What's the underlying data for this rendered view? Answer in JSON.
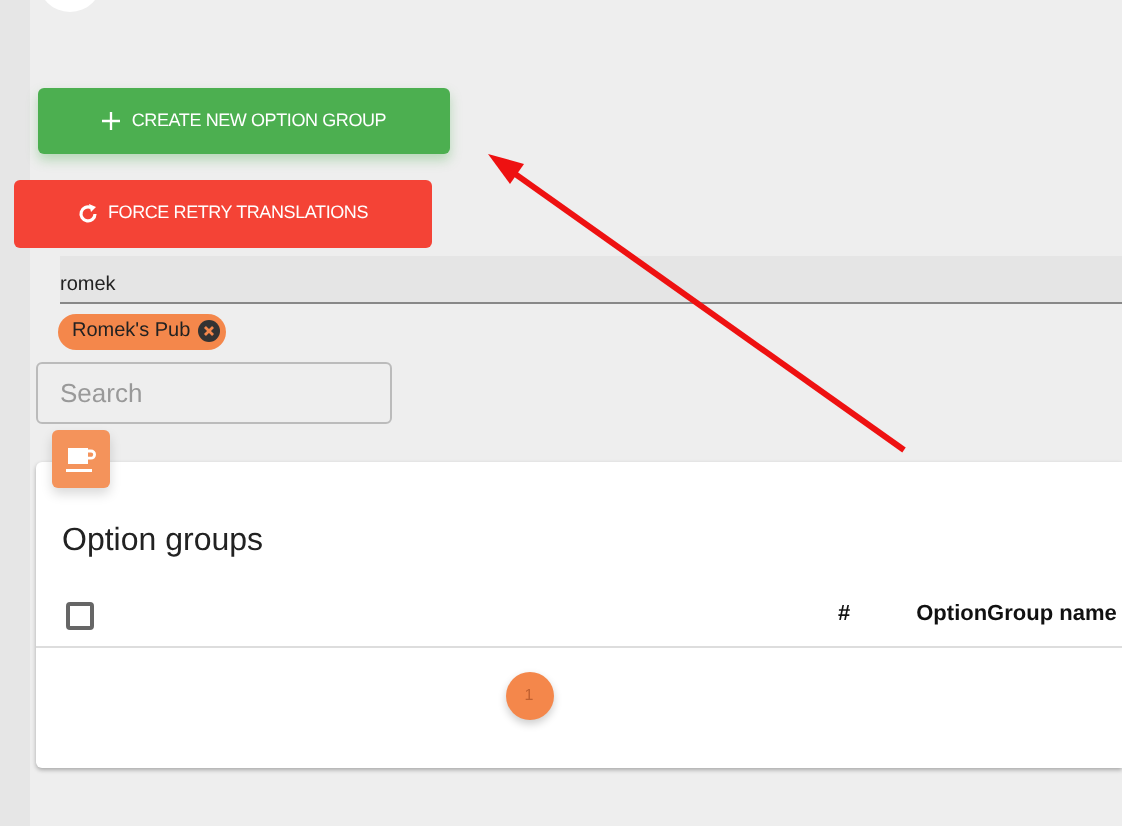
{
  "create_button": {
    "label": "CREATE NEW OPTION GROUP"
  },
  "retry_button": {
    "label": "FORCE RETRY TRANSLATIONS"
  },
  "restaurant_filter": {
    "value": "romek",
    "chips": [
      {
        "label": "Romek's Pub"
      }
    ]
  },
  "search": {
    "placeholder": "Search"
  },
  "card": {
    "title": "Option groups",
    "columns": [
      {
        "kind": "checkbox",
        "checked": false
      },
      {
        "kind": "text",
        "label": "#"
      },
      {
        "kind": "text",
        "label": "OptionGroup name"
      }
    ],
    "pagination": [
      {
        "label": "1",
        "selected": true
      }
    ]
  }
}
